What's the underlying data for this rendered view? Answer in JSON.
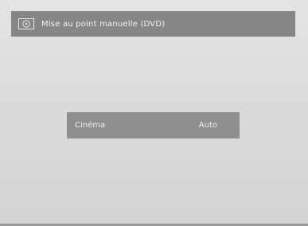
{
  "title_bar": {
    "icon": "dvd-disc-icon",
    "title": "Mise au point manuelle (DVD)"
  },
  "setting": {
    "label": "Cinéma",
    "value": "Auto"
  },
  "colors": {
    "background": "#d9d9d9",
    "title_bar": "#868686",
    "setting_row": "#8f8f8f",
    "text": "#f0f0f0"
  }
}
